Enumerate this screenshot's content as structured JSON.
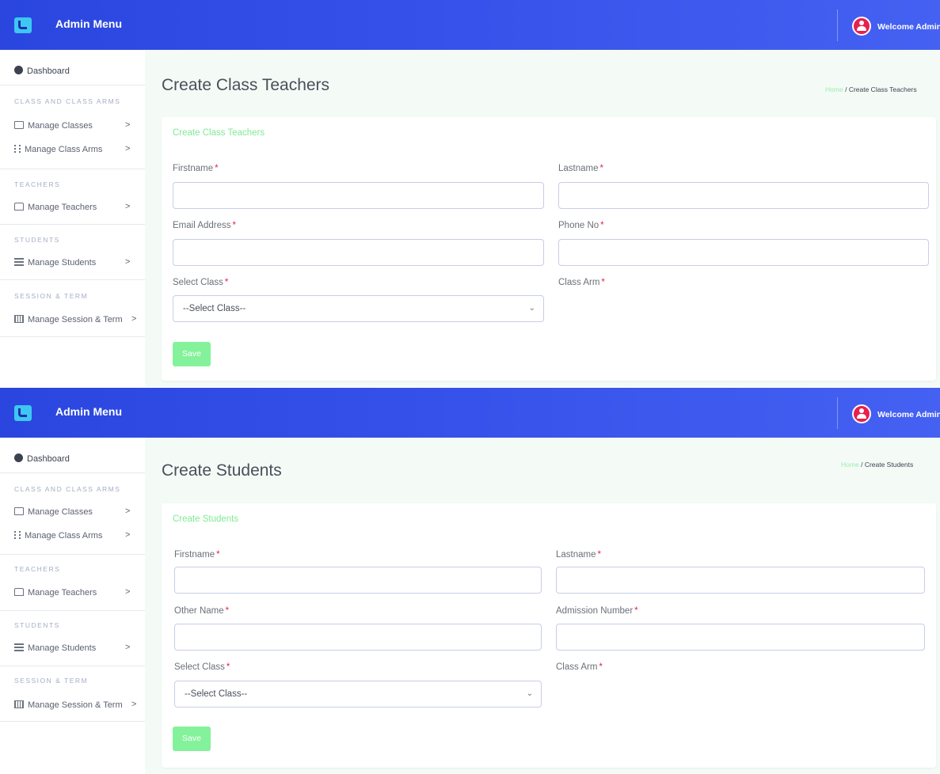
{
  "screens": [
    {
      "brand": "Admin Menu",
      "welcome": "Welcome Admin",
      "sidebar": {
        "dashboard": "Dashboard",
        "sections": [
          {
            "heading": "CLASS AND CLASS ARMS",
            "items": [
              "Manage Classes",
              "Manage Class Arms"
            ]
          },
          {
            "heading": "TEACHERS",
            "items": [
              "Manage Teachers"
            ]
          },
          {
            "heading": "STUDENTS",
            "items": [
              "Manage Students"
            ]
          },
          {
            "heading": "SESSION & TERM",
            "items": [
              "Manage Session & Term"
            ]
          }
        ],
        "chevron": ">"
      },
      "page_title": "Create Class Teachers",
      "breadcrumb": {
        "home": "Home",
        "separator": "/",
        "current": "Create Class Teachers"
      },
      "card_title": "Create Class Teachers",
      "fields": {
        "f1": "Firstname",
        "f2": "Lastname",
        "f3": "Email Address",
        "f4": "Phone No",
        "f5": "Select Class",
        "f6": "Class Arm"
      },
      "required_mark": "*",
      "select_value": "--Select Class--",
      "save_label": "Save"
    },
    {
      "brand": "Admin Menu",
      "welcome": "Welcome Admin",
      "sidebar": {
        "dashboard": "Dashboard",
        "sections": [
          {
            "heading": "CLASS AND CLASS ARMS",
            "items": [
              "Manage Classes",
              "Manage Class Arms"
            ]
          },
          {
            "heading": "TEACHERS",
            "items": [
              "Manage Teachers"
            ]
          },
          {
            "heading": "STUDENTS",
            "items": [
              "Manage Students"
            ]
          },
          {
            "heading": "SESSION & TERM",
            "items": [
              "Manage Session & Term"
            ]
          }
        ],
        "chevron": ">"
      },
      "page_title": "Create Students",
      "breadcrumb": {
        "home": "Home",
        "separator": "/",
        "current": "Create Students"
      },
      "card_title": "Create Students",
      "fields": {
        "f1": "Firstname",
        "f2": "Lastname",
        "f3": "Other Name",
        "f4": "Admission Number",
        "f5": "Select Class",
        "f6": "Class Arm"
      },
      "required_mark": "*",
      "select_value": "--Select Class--",
      "save_label": "Save"
    }
  ],
  "colors": {
    "topbar": "#3652ea",
    "accent_green": "#84f29a",
    "required": "#e8204e",
    "avatar": "#e8204e"
  }
}
